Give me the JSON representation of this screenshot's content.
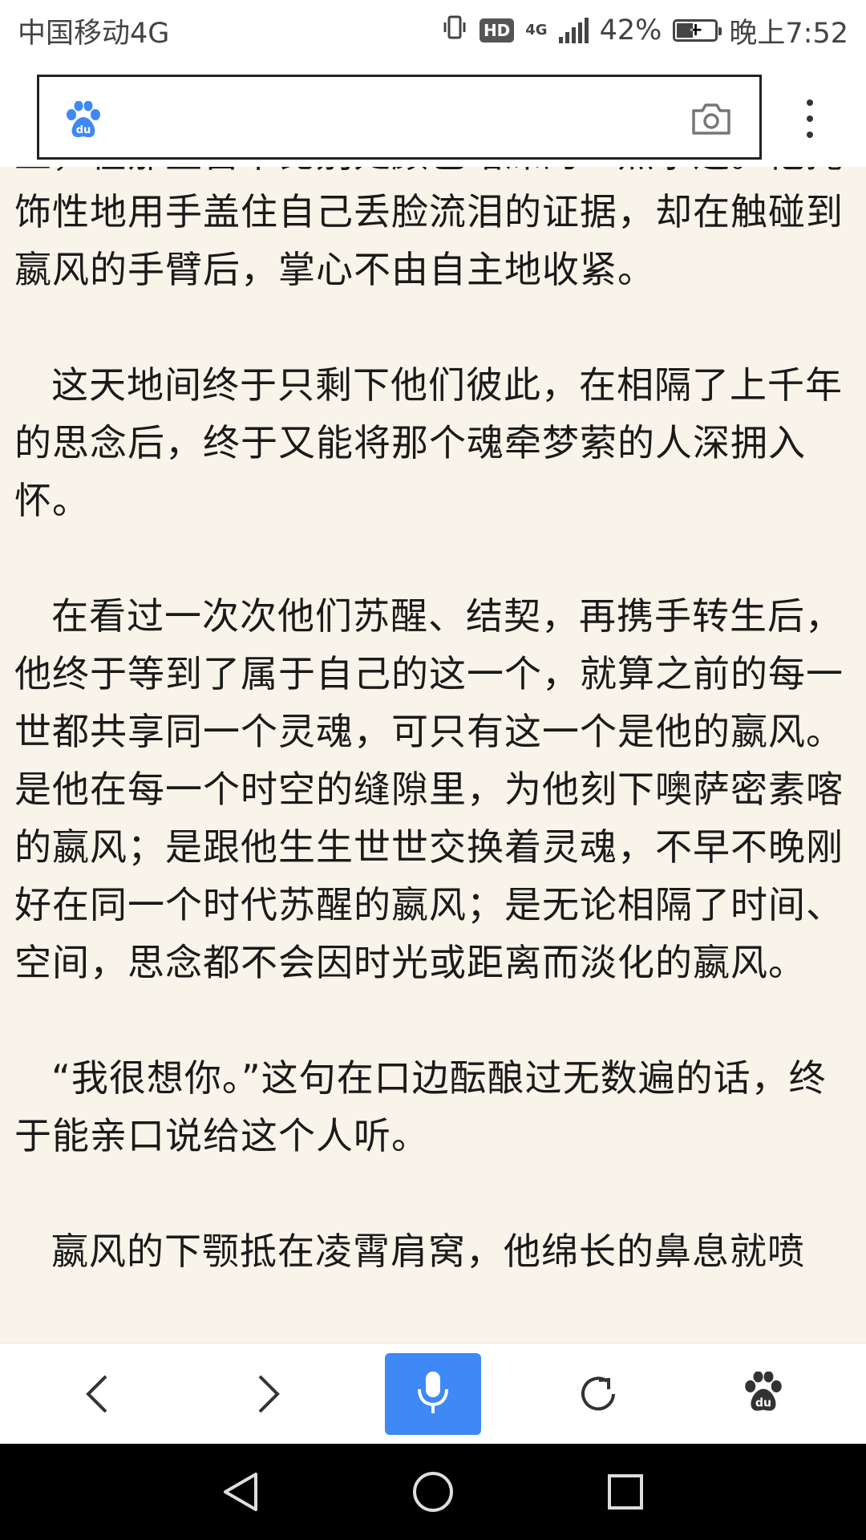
{
  "status_bar": {
    "carrier": "中国移动4G",
    "hd": "HD",
    "network": "4G",
    "battery": "42%",
    "battery_level": 0.42,
    "time": "晚上7:52"
  },
  "header": {
    "logo_icon": "baidu-paw-icon",
    "camera_icon": "camera-icon",
    "menu_icon": "more-vertical-icon"
  },
  "article": {
    "paragraphs": [
      "上，在那里留下比别处颜色略深的一点水迹。他掩饰性地用手盖住自己丢脸流泪的证据，却在触碰到嬴风的手臂后，掌心不由自主地收紧。",
      "这天地间终于只剩下他们彼此，在相隔了上千年的思念后，终于又能将那个魂牵梦萦的人深拥入怀。",
      "在看过一次次他们苏醒、结契，再携手转生后，他终于等到了属于自己的这一个，就算之前的每一世都共享同一个灵魂，可只有这一个是他的嬴风。是他在每一个时空的缝隙里，为他刻下噢萨密素喀的嬴风；是跟他生生世世交换着灵魂，不早不晚刚好在同一个时代苏醒的嬴风；是无论相隔了时间、空间，思念都不会因时光或距离而淡化的嬴风。",
      "“我很想你。”这句在口边酝酿过无数遍的话，终于能亲口说给这个人听。",
      "嬴风的下颚抵在凌霄肩窝，他绵长的鼻息就喷"
    ]
  },
  "toolbar": {
    "back_icon": "chevron-left-icon",
    "forward_icon": "chevron-right-icon",
    "voice_icon": "microphone-icon",
    "refresh_icon": "refresh-icon",
    "home_icon": "baidu-paw-icon",
    "accent_color": "#3f89f7"
  },
  "nav_bar": {
    "back_icon": "triangle-back-icon",
    "home_icon": "circle-home-icon",
    "recents_icon": "square-recents-icon"
  }
}
